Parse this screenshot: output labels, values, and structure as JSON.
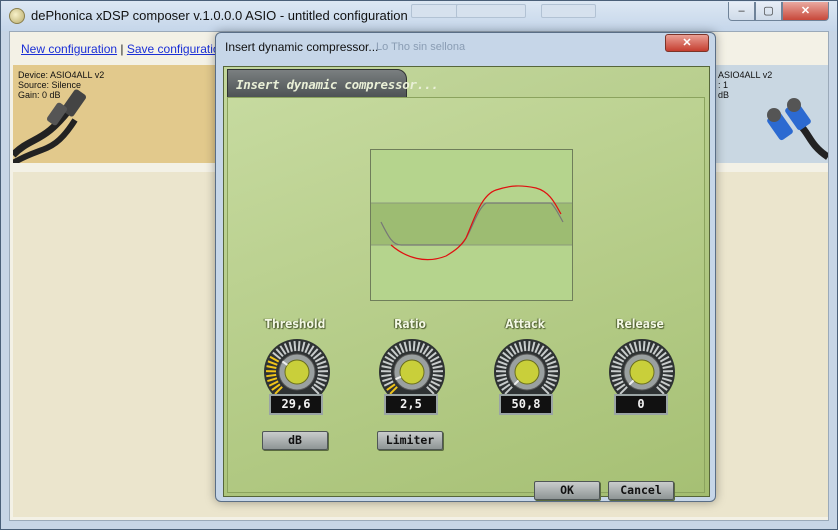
{
  "main_window": {
    "title": "dePhonica xDSP composer v.1.0.0.0 ASIO - untitled configuration",
    "minimize": "–",
    "maximize": "▢",
    "close": "✕"
  },
  "links": {
    "new_configuration": "New configuration",
    "separator": "|",
    "save_configuration": "Save configuration",
    "separator2": "|"
  },
  "device_left": {
    "device": "Device: ASIO4ALL v2",
    "source": "Source: Silence",
    "gain": "Gain: 0 dB"
  },
  "device_right": {
    "device": "ASIO4ALL v2",
    "line2": ": 1",
    "line3": "dB"
  },
  "dialog": {
    "title": "Insert dynamic compressor...",
    "ghost_text": "Lo   Tho sin sellona",
    "close": "✕",
    "tab_title": "Insert dynamic compressor...",
    "knobs": [
      {
        "label": "Threshold",
        "value": "29,6",
        "level_fraction": 0.3,
        "accent": "#f0c419"
      },
      {
        "label": "Ratio",
        "value": "2,5",
        "level_fraction": 0.08,
        "accent": "#f0c419"
      },
      {
        "label": "Attack",
        "value": "50,8",
        "level_fraction": 0.0,
        "accent": "#f0c419"
      },
      {
        "label": "Release",
        "value": "0",
        "level_fraction": 0.0,
        "accent": "#f0c419"
      }
    ],
    "threshold_unit": "dB",
    "ratio_mode": "Limiter",
    "ok_label": "OK",
    "cancel_label": "Cancel"
  },
  "colors": {
    "curve_input": "#777777",
    "curve_output": "#e01010",
    "knob_led": "#f0c419"
  }
}
